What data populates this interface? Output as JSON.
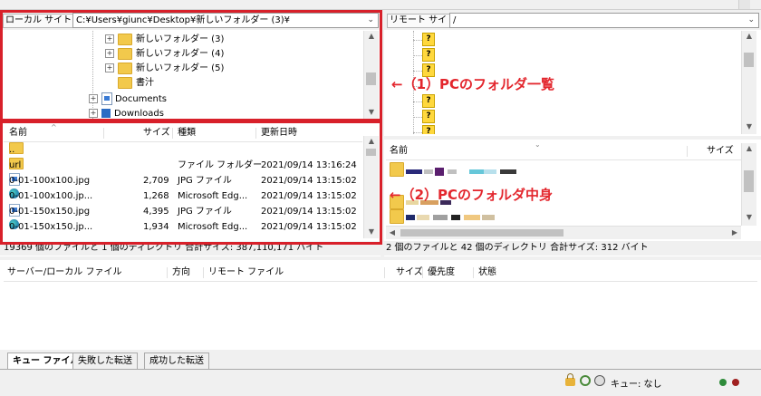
{
  "local": {
    "site_label": "ローカル サイト:",
    "path": "C:¥Users¥giunc¥Desktop¥新しいフォルダー (3)¥",
    "tree": [
      {
        "label": "新しいフォルダー (3)",
        "expander": "+"
      },
      {
        "label": "新しいフォルダー (4)",
        "expander": "+"
      },
      {
        "label": "新しいフォルダー (5)",
        "expander": "+"
      },
      {
        "label": "書汁",
        "expander": ""
      },
      {
        "label": "Documents",
        "expander": "+"
      },
      {
        "label": "Downloads",
        "expander": "+"
      }
    ],
    "columns": {
      "name": "名前",
      "size": "サイズ",
      "type": "種類",
      "modified": "更新日時"
    },
    "files": [
      {
        "name": "..",
        "size": "",
        "type": "",
        "modified": "",
        "icon": "folder-icon"
      },
      {
        "name": "url",
        "size": "",
        "type": "ファイル フォルダー",
        "modified": "2021/09/14 13:16:24",
        "icon": "folder-icon"
      },
      {
        "name": "0-01-100x100.jpg",
        "size": "2,709",
        "type": "JPG ファイル",
        "modified": "2021/09/14 13:15:02",
        "icon": "jpg-file-icon"
      },
      {
        "name": "0-01-100x100.jp...",
        "size": "1,268",
        "type": "Microsoft Edg...",
        "modified": "2021/09/14 13:15:02",
        "icon": "edge-icon"
      },
      {
        "name": "0-01-150x150.jpg",
        "size": "4,395",
        "type": "JPG ファイル",
        "modified": "2021/09/14 13:15:02",
        "icon": "jpg-file-icon"
      },
      {
        "name": "0-01-150x150.jp...",
        "size": "1,934",
        "type": "Microsoft Edg...",
        "modified": "2021/09/14 13:15:02",
        "icon": "edge-icon"
      }
    ],
    "status": "19369 個のファイルと 1 個のディレクトリ 合計サイズ: 387,110,171 バイト"
  },
  "remote": {
    "site_label": "リモート サイト:",
    "path": "/",
    "tree_marks": [
      "?",
      "?",
      "?",
      "?",
      "?",
      "?"
    ],
    "columns": {
      "name": "名前",
      "size": "サイズ"
    },
    "status": "2 個のファイルと 42 個のディレクトリ 合計サイズ: 312 バイト"
  },
  "annotations": {
    "one": "←（1）PCのフォルダ一覧",
    "two": "←（2）PCのフォルダ中身"
  },
  "queue": {
    "columns": {
      "server_local": "サーバー/ローカル ファイル",
      "direction": "方向",
      "remote_file": "リモート ファイル",
      "size": "サイズ",
      "priority": "優先度",
      "status": "状態"
    },
    "tabs": [
      "キュー ファイル",
      "失敗した転送",
      "成功した転送"
    ],
    "queue_status": "キュー: なし"
  },
  "colors": {
    "accent_red": "#d8202a",
    "folder": "#f2c94c"
  }
}
